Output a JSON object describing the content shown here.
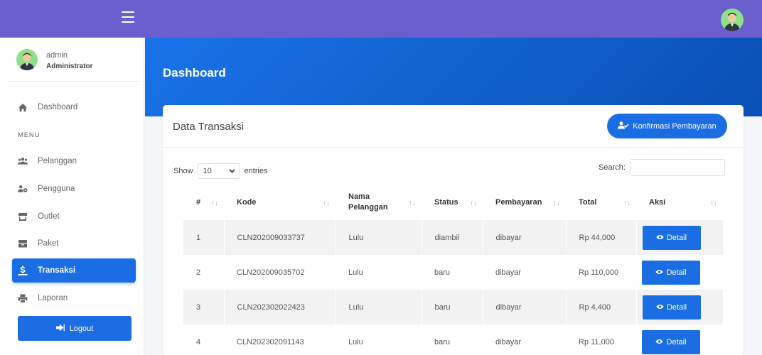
{
  "sidebar": {
    "user_name": "admin",
    "user_role": "Administrator",
    "dashboard_label": "Dashboard",
    "menu_heading": "MENU",
    "items": [
      {
        "label": "Pelanggan",
        "icon": "users-icon"
      },
      {
        "label": "Pengguna",
        "icon": "user-gear-icon"
      },
      {
        "label": "Outlet",
        "icon": "store-icon"
      },
      {
        "label": "Paket",
        "icon": "box-icon"
      },
      {
        "label": "Transaksi",
        "icon": "money-icon"
      },
      {
        "label": "Laporan",
        "icon": "printer-icon"
      }
    ],
    "logout_label": "Logout"
  },
  "header": {
    "page_title": "Dashboard"
  },
  "card": {
    "title": "Data Transaksi",
    "confirm_label": "Konfirmasi Pembayaran",
    "show_label": "Show",
    "entries_value": "10",
    "entries_label": "entries",
    "search_label": "Search:"
  },
  "table": {
    "columns": [
      "#",
      "Kode",
      "Nama Pelanggan",
      "Status",
      "Pembayaran",
      "Total",
      "Aksi"
    ],
    "rows": [
      {
        "no": "1",
        "kode": "CLN202009033737",
        "nama": "Lulu",
        "status": "diambil",
        "bayar": "dibayar",
        "total": "Rp 44,000"
      },
      {
        "no": "2",
        "kode": "CLN202009035702",
        "nama": "Lulu",
        "status": "baru",
        "bayar": "dibayar",
        "total": "Rp 110,000"
      },
      {
        "no": "3",
        "kode": "CLN202302022423",
        "nama": "Lulu",
        "status": "baru",
        "bayar": "dibayar",
        "total": "Rp 4,400"
      },
      {
        "no": "4",
        "kode": "CLN202302091143",
        "nama": "Lulu",
        "status": "baru",
        "bayar": "dibayar",
        "total": "Rp 11,000"
      }
    ],
    "detail_label": "Detail"
  },
  "colors": {
    "topbar": "#6a5fcd",
    "primary": "#1b6de3",
    "avatar_bg": "#8fe08a"
  }
}
